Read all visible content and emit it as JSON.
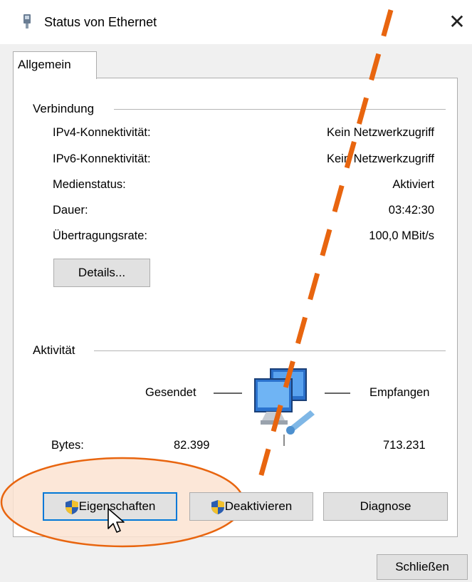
{
  "window": {
    "title": "Status von Ethernet",
    "close_icon": "close-icon",
    "app_icon": "network-adapter-icon"
  },
  "tabs": [
    {
      "label": "Allgemein",
      "active": true
    }
  ],
  "connection": {
    "group_label": "Verbindung",
    "rows": [
      {
        "label": "IPv4-Konnektivität:",
        "value": "Kein Netzwerkzugriff"
      },
      {
        "label": "IPv6-Konnektivität:",
        "value": "Kein Netzwerkzugriff"
      },
      {
        "label": "Medienstatus:",
        "value": "Aktiviert"
      },
      {
        "label": "Dauer:",
        "value": "03:42:30"
      },
      {
        "label": "Übertragungsrate:",
        "value": "100,0 MBit/s"
      }
    ],
    "details_button": "Details..."
  },
  "activity": {
    "group_label": "Aktivität",
    "sent_label": "Gesendet",
    "received_label": "Empfangen",
    "bytes_label": "Bytes:",
    "bytes_sent": "82.399",
    "bytes_received": "713.231"
  },
  "actions": {
    "properties_button": "Eigenschaften",
    "disable_button": "Deaktivieren",
    "diagnose_button": "Diagnose",
    "close_button": "Schließen"
  },
  "annotations": {
    "dashed_line_color": "#e8650f",
    "highlight_ellipse_color": "#e8650f",
    "highlight_fill": "#fbe3d1"
  }
}
